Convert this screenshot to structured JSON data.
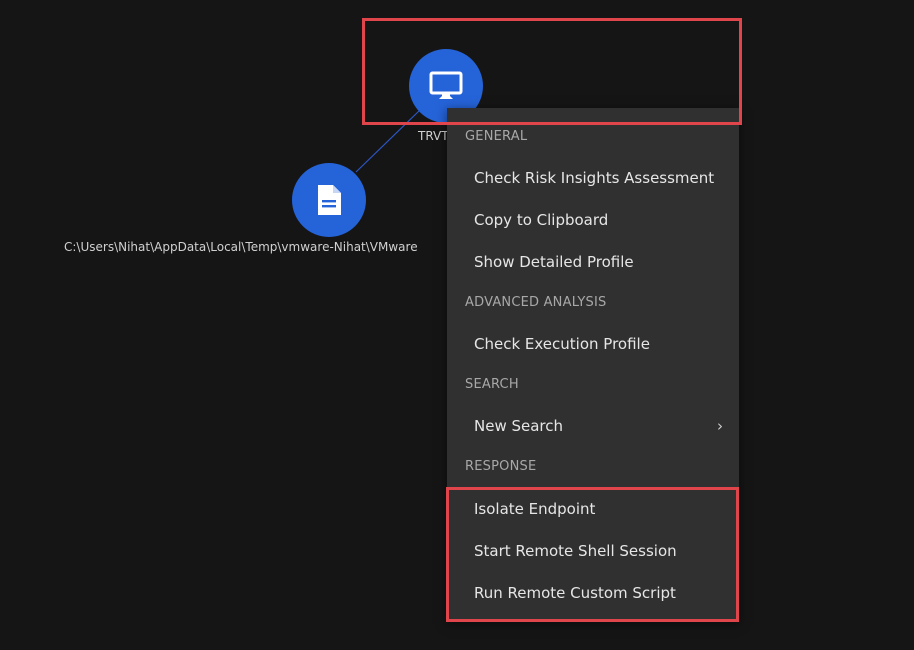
{
  "graph": {
    "endpoint_node": {
      "label": "TRVT",
      "icon": "monitor-icon",
      "color": "#2563d8"
    },
    "file_node": {
      "label": "C:\\Users\\Nihat\\AppData\\Local\\Temp\\vmware-Nihat\\VMware",
      "icon": "document-icon",
      "color": "#2563d8"
    },
    "edge_color": "#2d56c4"
  },
  "context_menu": {
    "sections": {
      "general": {
        "header": "GENERAL",
        "items": [
          "Check Risk Insights Assessment",
          "Copy to Clipboard",
          "Show Detailed Profile"
        ]
      },
      "advanced_analysis": {
        "header": "ADVANCED ANALYSIS",
        "items": [
          "Check Execution Profile"
        ]
      },
      "search": {
        "header": "SEARCH",
        "items": [
          "New Search"
        ],
        "submenu_icon": "chevron-right-icon"
      },
      "response": {
        "header": "RESPONSE",
        "items": [
          "Isolate Endpoint",
          "Start Remote Shell Session",
          "Run Remote Custom Script"
        ]
      }
    }
  },
  "colors": {
    "background": "#151515",
    "menu_background": "#303030",
    "highlight": "#e0454c",
    "node_blue": "#2563d8"
  }
}
